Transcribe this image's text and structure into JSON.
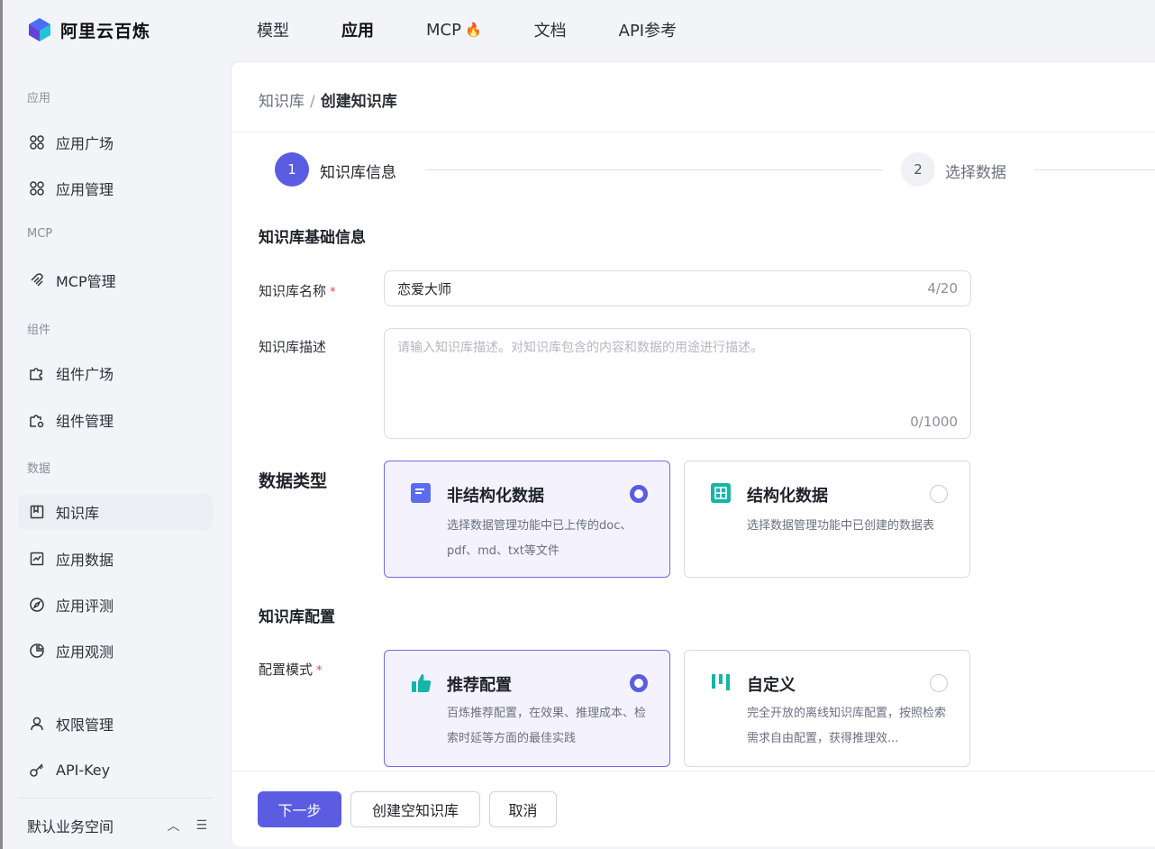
{
  "app": {
    "name": "阿里云百炼"
  },
  "topnav": [
    {
      "label": "模型",
      "active": false
    },
    {
      "label": "应用",
      "active": true
    },
    {
      "label": "MCP",
      "active": false,
      "hot": true
    },
    {
      "label": "文档",
      "active": false
    },
    {
      "label": "API参考",
      "active": false
    }
  ],
  "sidebar": {
    "groups": {
      "app": "应用",
      "mcp": "MCP",
      "component": "组件",
      "data": "数据"
    },
    "items": [
      {
        "label": "应用广场",
        "icon": "grid-icon"
      },
      {
        "label": "应用管理",
        "icon": "grid-icon"
      },
      {
        "label": "MCP管理",
        "icon": "mcp-icon"
      },
      {
        "label": "组件广场",
        "icon": "puzzle-icon"
      },
      {
        "label": "组件管理",
        "icon": "puzzle-settings-icon"
      },
      {
        "label": "知识库",
        "icon": "book-icon",
        "active": true
      },
      {
        "label": "应用数据",
        "icon": "chart-icon"
      },
      {
        "label": "应用评测",
        "icon": "compass-icon"
      },
      {
        "label": "应用观测",
        "icon": "pie-icon"
      },
      {
        "label": "权限管理",
        "icon": "user-icon"
      },
      {
        "label": "API-Key",
        "icon": "key-icon"
      }
    ],
    "workspace": "默认业务空间"
  },
  "breadcrumb": {
    "parent": "知识库",
    "separator": "/",
    "current": "创建知识库"
  },
  "steps": [
    {
      "number": "1",
      "label": "知识库信息",
      "active": true
    },
    {
      "number": "2",
      "label": "选择数据",
      "active": false
    }
  ],
  "form": {
    "basic_title": "知识库基础信息",
    "name_label": "知识库名称",
    "name_value": "恋爱大师",
    "name_count": "4/20",
    "desc_label": "知识库描述",
    "desc_placeholder": "请输入知识库描述。对知识库包含的内容和数据的用途进行描述。",
    "desc_count": "0/1000",
    "data_type_title": "数据类型",
    "data_types": [
      {
        "title": "非结构化数据",
        "desc": "选择数据管理功能中已上传的doc、pdf、md、txt等文件",
        "selected": true
      },
      {
        "title": "结构化数据",
        "desc": "选择数据管理功能中已创建的数据表",
        "selected": false
      }
    ],
    "config_title": "知识库配置",
    "config_mode_label": "配置模式",
    "config_modes": [
      {
        "title": "推荐配置",
        "desc": "百炼推荐配置，在效果、推理成本、检索时延等方面的最佳实践",
        "selected": true
      },
      {
        "title": "自定义",
        "desc": "完全开放的离线知识库配置，按照检索需求自由配置，获得推理效...",
        "selected": false
      }
    ]
  },
  "buttons": {
    "next": "下一步",
    "create_empty": "创建空知识库",
    "cancel": "取消"
  },
  "colors": {
    "accent": "#5b5ce2",
    "selected_bg": "#f3f2fd",
    "required": "#e5484d",
    "teal_icon": "#16b5a6"
  }
}
